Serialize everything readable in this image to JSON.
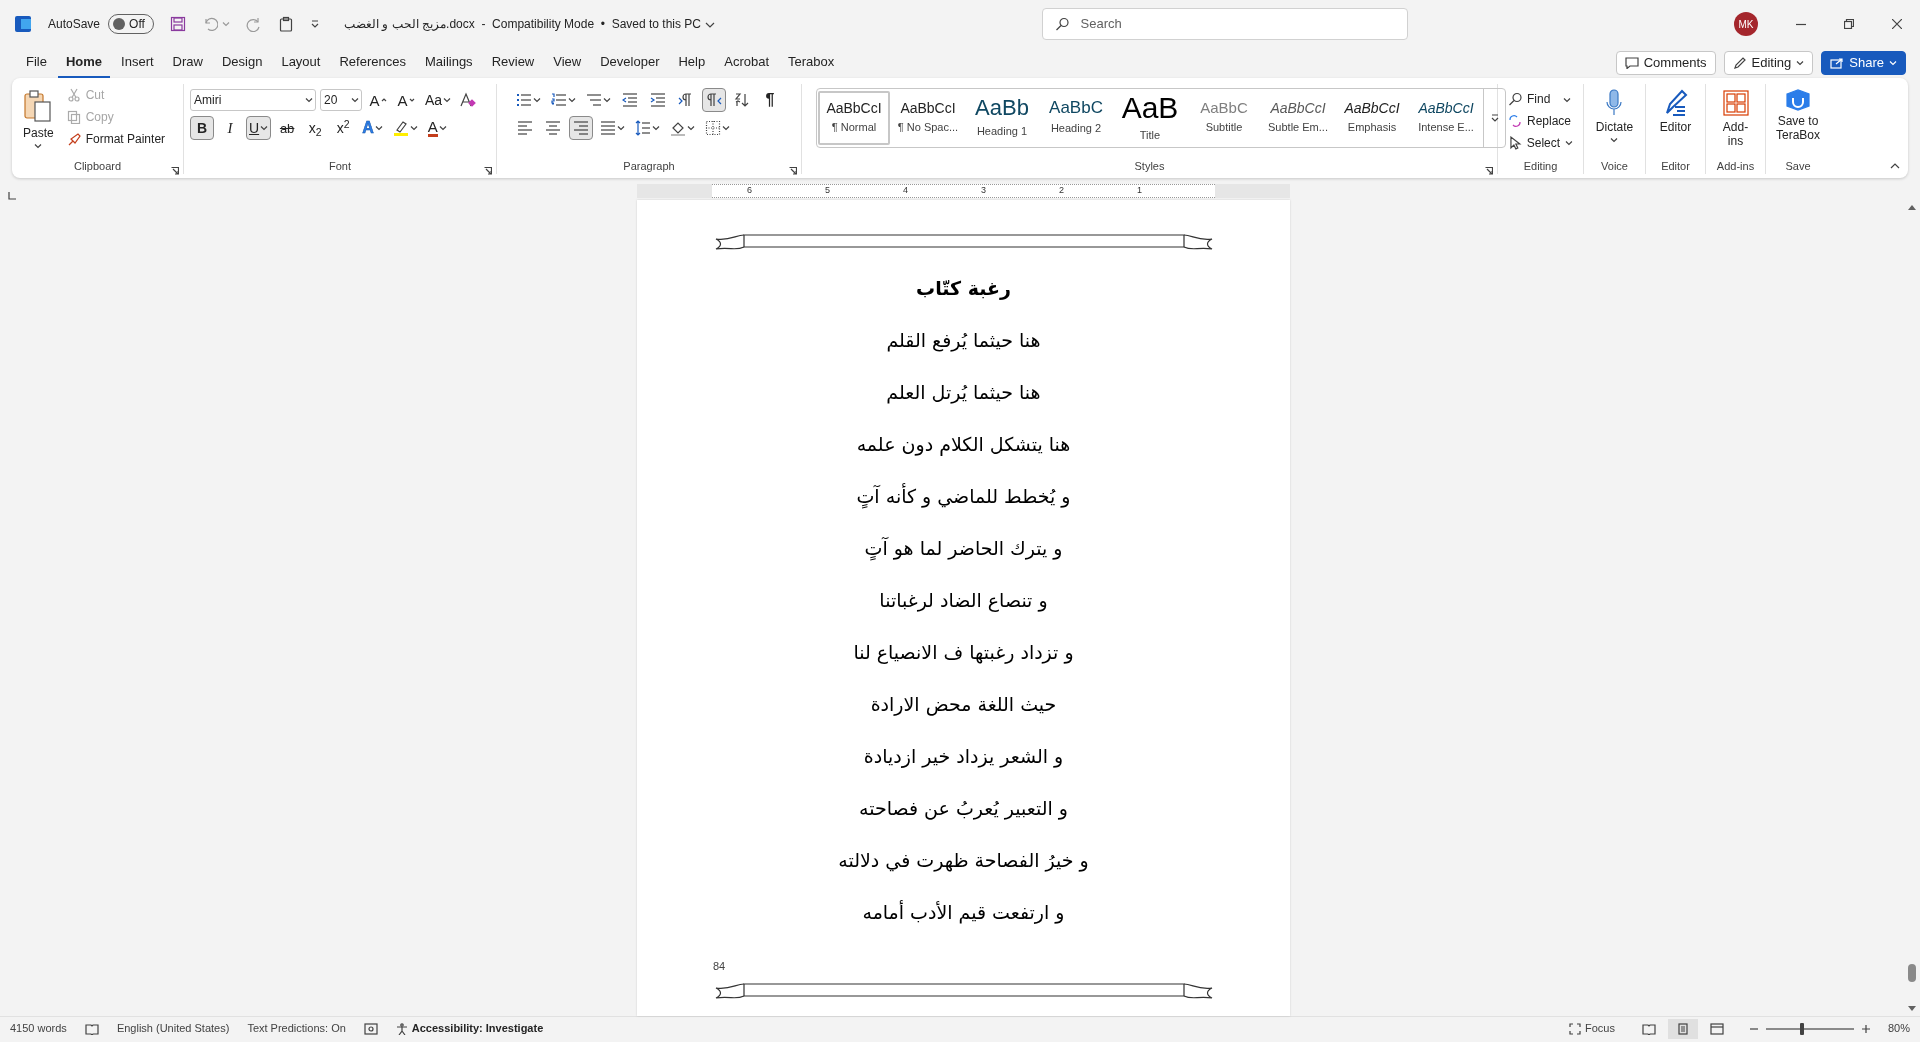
{
  "title_bar": {
    "autosave": {
      "label": "AutoSave",
      "on": false,
      "state": "Off"
    },
    "document_title": "مزيج الحب و الغضب.docx  -  Compatibility Mode  •  Saved to this PC",
    "search": {
      "placeholder": "Search"
    },
    "avatar": "MK"
  },
  "menu_tabs": [
    {
      "label": "File",
      "selected": false
    },
    {
      "label": "Home",
      "selected": true
    },
    {
      "label": "Insert",
      "selected": false
    },
    {
      "label": "Draw",
      "selected": false
    },
    {
      "label": "Design",
      "selected": false
    },
    {
      "label": "Layout",
      "selected": false
    },
    {
      "label": "References",
      "selected": false
    },
    {
      "label": "Mailings",
      "selected": false
    },
    {
      "label": "Review",
      "selected": false
    },
    {
      "label": "View",
      "selected": false
    },
    {
      "label": "Developer",
      "selected": false
    },
    {
      "label": "Help",
      "selected": false
    },
    {
      "label": "Acrobat",
      "selected": false
    },
    {
      "label": "Terabox",
      "selected": false
    }
  ],
  "top_actions": {
    "comments": "Comments",
    "editing": "Editing",
    "share": "Share"
  },
  "ribbon": {
    "clipboard": {
      "label": "Clipboard",
      "paste": "Paste",
      "cut": {
        "label": "Cut",
        "disabled": true
      },
      "copy": {
        "label": "Copy",
        "disabled": true
      },
      "format_painter": "Format Painter"
    },
    "font": {
      "label": "Font",
      "font_name": "Amiri",
      "font_size": "20",
      "row1": [
        {
          "kind": "grow",
          "glyph": "A"
        },
        {
          "kind": "shrink",
          "glyph": "A"
        },
        {
          "kind": "case",
          "glyph": "Aa"
        }
      ],
      "row2": [
        {
          "kind": "bold",
          "glyph": "B",
          "pressed": true
        },
        {
          "kind": "italic",
          "glyph": "I",
          "pressed": false
        },
        {
          "kind": "underline",
          "glyph": "U",
          "pressed": true
        },
        {
          "kind": "strike",
          "glyph": "ab",
          "pressed": false
        },
        {
          "kind": "subscript",
          "glyph": "x$_{2}$",
          "pressed": false
        },
        {
          "kind": "superscript",
          "glyph": "x$^{2}$",
          "pressed": false
        },
        {
          "kind": "effects",
          "glyph": "A",
          "pressed": false
        },
        {
          "kind": "highlight",
          "pressed": false
        },
        {
          "kind": "color",
          "glyph": "A",
          "pressed": false
        }
      ]
    },
    "paragraph": {
      "label": "Paragraph",
      "row1": [
        {
          "kind": "bullets",
          "pressed": false
        },
        {
          "kind": "numbering",
          "pressed": false
        },
        {
          "kind": "multilevel",
          "pressed": false
        },
        {
          "kind": "decrease-indent",
          "pressed": false
        },
        {
          "kind": "increase-indent",
          "pressed": false
        },
        {
          "kind": "ltr",
          "pressed": false
        },
        {
          "kind": "rtl",
          "pressed": true
        },
        {
          "kind": "sort",
          "pressed": false
        },
        {
          "kind": "marks",
          "glyph": "¶",
          "pressed": false
        }
      ],
      "row2": [
        {
          "kind": "align-left",
          "pressed": false
        },
        {
          "kind": "center",
          "pressed": false
        },
        {
          "kind": "align-right",
          "pressed": true
        },
        {
          "kind": "justify",
          "pressed": false
        },
        {
          "kind": "line-spacing",
          "pressed": false
        },
        {
          "kind": "shading",
          "pressed": false
        },
        {
          "kind": "borders",
          "pressed": false
        }
      ]
    },
    "styles": {
      "label": "Styles",
      "items": [
        {
          "kind": "normal",
          "preview": "AaBbCcI",
          "name": "¶ Normal",
          "selected": true
        },
        {
          "kind": "nospacing",
          "preview": "AaBbCcI",
          "name": "¶ No Spac...",
          "selected": false
        },
        {
          "kind": "heading1",
          "preview": "AaBb",
          "name": "Heading 1",
          "selected": false
        },
        {
          "kind": "heading2",
          "preview": "AaBbC",
          "name": "Heading 2",
          "selected": false
        },
        {
          "kind": "title",
          "preview": "AaB",
          "name": "Title",
          "selected": false
        },
        {
          "kind": "subtitle",
          "preview": "AaBbC",
          "name": "Subtitle",
          "selected": false
        },
        {
          "kind": "subtle",
          "preview": "AaBbCcI",
          "name": "Subtle Em...",
          "selected": false
        },
        {
          "kind": "emphasis",
          "preview": "AaBbCcI",
          "name": "Emphasis",
          "selected": false
        },
        {
          "kind": "intense",
          "preview": "AaBbCcI",
          "name": "Intense E...",
          "selected": false
        }
      ]
    },
    "editing": {
      "label": "Editing",
      "find": "Find",
      "replace": "Replace",
      "select": "Select"
    },
    "voice": {
      "label": "Voice",
      "dictate": "Dictate"
    },
    "editor": {
      "label": "Editor",
      "button": "Editor"
    },
    "addins": {
      "label": "Add-ins",
      "button": "Add-ins"
    },
    "save": {
      "label": "Save",
      "button": "Save to TeraBox"
    }
  },
  "ruler": {
    "numbers": [
      "6",
      "5",
      "4",
      "3",
      "2",
      "1"
    ]
  },
  "document": {
    "title": "رغبة كتّاب",
    "lines": [
      "هنا حيثما يُرفع القلم",
      "هنا حيثما يُرتل العلم",
      "هنا يتشكل الكلام دون علمه",
      "و يُخطط للماضي و كأنه آتٍ",
      "و يترك الحاضر لما هو آتٍ",
      "و تنصاع الضاد لرغباتنا",
      "و تزداد رغبتها ف الانصياع لنا",
      "حيث اللغة محض الارادة",
      "و الشعر يزداد خير ازديادة",
      "و التعبير يُعربُ عن فصاحته",
      "و خيرُ الفصاحة ظهرت في دلالته",
      "و ارتفعت قيم الأدب أمامه"
    ],
    "page_number": "84"
  },
  "status_bar": {
    "words": "4150 words",
    "language": "English (United States)",
    "predictions": "Text Predictions: On",
    "accessibility": "Accessibility: Investigate",
    "focus": "Focus",
    "views": [
      {
        "kind": "read",
        "selected": false
      },
      {
        "kind": "print",
        "selected": true
      },
      {
        "kind": "web",
        "selected": false
      }
    ],
    "zoom": {
      "level": 0.4,
      "value": "80%"
    }
  }
}
